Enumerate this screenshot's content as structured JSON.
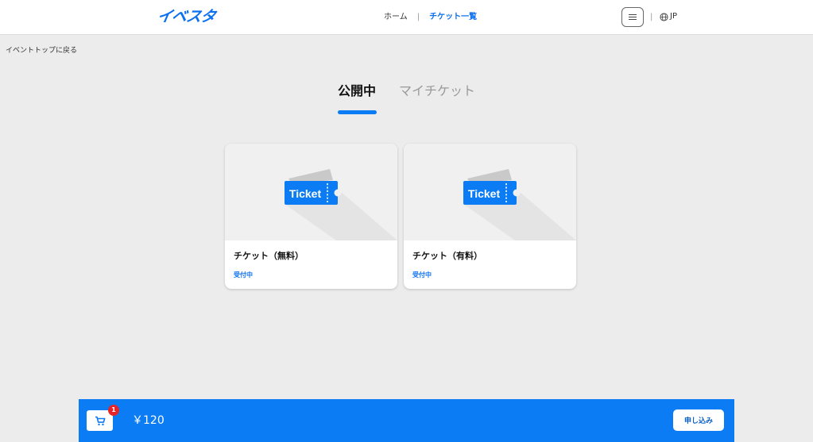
{
  "colors": {
    "accent": "#0b7cf3",
    "link_blue": "#0b6ff0",
    "badge_red": "#e5242a"
  },
  "header": {
    "logo": "イベスタ",
    "nav": {
      "home": "ホーム",
      "separator": "|",
      "tickets": "チケット一覧"
    },
    "menu_icon": "hamburger-icon",
    "lang_separator": "|",
    "lang_icon": "globe-icon",
    "lang": "JP"
  },
  "back_link": "イベントトップに戻る",
  "tabs": [
    {
      "label": "公開中",
      "active": true
    },
    {
      "label": "マイチケット",
      "active": false
    }
  ],
  "tickets": [
    {
      "image_text": "Ticket",
      "title": "チケット（無料）",
      "status": "受付中"
    },
    {
      "image_text": "Ticket",
      "title": "チケット（有料）",
      "status": "受付中"
    }
  ],
  "cart": {
    "icon": "cart-icon",
    "badge_count": "1",
    "price": "￥120",
    "apply_label": "申し込み"
  }
}
